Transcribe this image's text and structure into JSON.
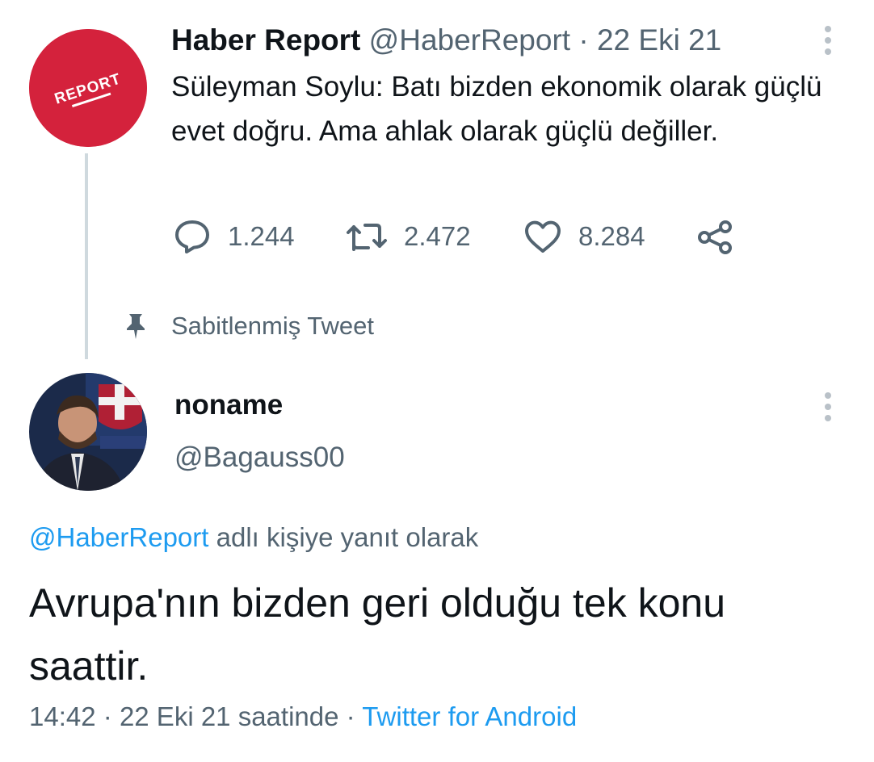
{
  "parent_tweet": {
    "author_name": "Haber Report",
    "author_handle": "@HaberReport",
    "separator": "·",
    "date": "22 Eki 21",
    "text": "Süleyman Soylu: Batı bizden ekonomik olarak güçlü evet doğru. Ama ahlak olarak güçlü değiller.",
    "avatar_text": "REPORT",
    "avatar_color": "#d4223c",
    "actions": {
      "reply_count": "1.244",
      "retweet_count": "2.472",
      "like_count": "8.284"
    }
  },
  "pinned": {
    "label": "Sabitlenmiş Tweet"
  },
  "reply_tweet": {
    "author_name": "noname",
    "author_handle": "@Bagauss00",
    "reply_mention": "@HaberReport",
    "reply_suffix": "adlı kişiye yanıt olarak",
    "text": "Avrupa'nın bizden geri olduğu tek konu saattir.",
    "time": "14:42",
    "separator": "·",
    "date_suffix": "22 Eki 21 saatinde",
    "source": "Twitter for Android"
  },
  "colors": {
    "link": "#1d9bf0",
    "secondary_text": "#536471",
    "primary_text": "#0f1419"
  }
}
